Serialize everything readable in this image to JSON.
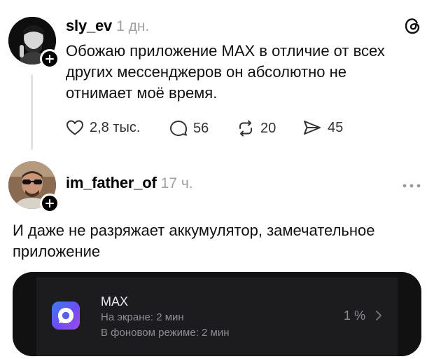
{
  "posts": [
    {
      "username": "sly_ev",
      "time": "1 дн.",
      "text_lines": [
        "Обожаю приложение MAX в отличие от всех",
        "других мессенджеров он абсолютно не",
        "отнимает моё время."
      ],
      "actions": {
        "likes": "2,8 тыс.",
        "replies": "56",
        "reposts": "20",
        "shares": "45"
      }
    },
    {
      "username": "im_father_of",
      "time": "17 ч.",
      "text_lines": [
        "И даже не разряжает аккумулятор, замечательное",
        "приложение"
      ]
    }
  ],
  "battery_card": {
    "app_name": "MAX",
    "on_screen": "На экране: 2 мин",
    "background": "В фоновом режиме: 2 мин",
    "percent": "1 %"
  },
  "icons": {
    "threads": "threads-logo-icon",
    "like": "heart-icon",
    "reply": "comment-icon",
    "repost": "repost-icon",
    "share": "send-icon",
    "more": "more-dots-icon",
    "chevron": "chevron-right-icon"
  },
  "colors": {
    "text": "#000000",
    "muted": "#a0a0a0",
    "card_bg": "#1c1c1e"
  }
}
